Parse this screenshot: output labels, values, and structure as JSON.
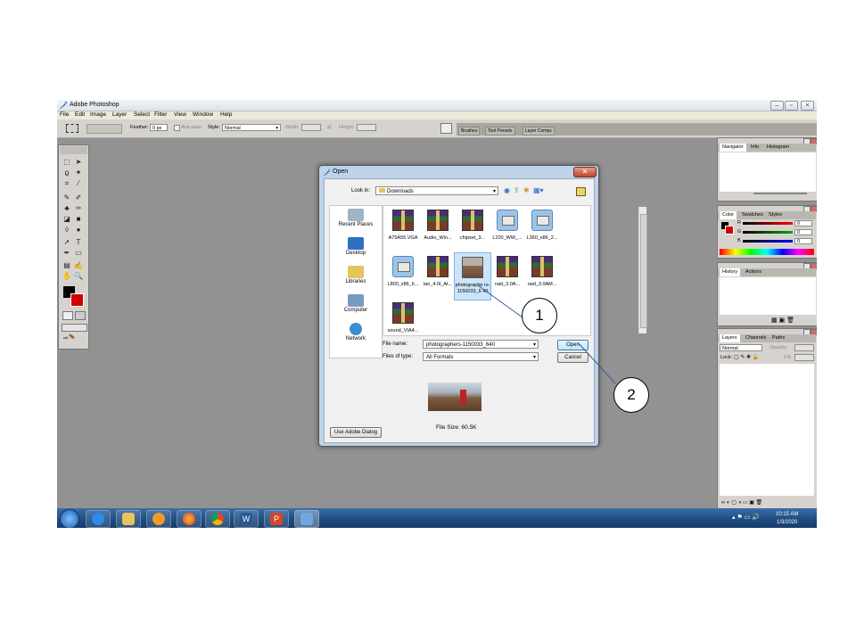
{
  "window": {
    "title": "Adobe Photoshop"
  },
  "menu": [
    "File",
    "Edit",
    "Image",
    "Layer",
    "Select",
    "Filter",
    "View",
    "Window",
    "Help"
  ],
  "options": {
    "feather_label": "Feather:",
    "feather_value": "0 px",
    "antialias_label": "Anti-alias",
    "style_label": "Style:",
    "style_value": "Normal",
    "width_label": "Width:",
    "height_label": "Height:",
    "tabs": [
      "Brushes",
      "Tool Presets",
      "Layer Comps"
    ]
  },
  "panels": {
    "nav": {
      "tabs": [
        "Navigator",
        "Info",
        "Histogram"
      ]
    },
    "color": {
      "tabs": [
        "Color",
        "Swatches",
        "Styles"
      ],
      "r_label": "R",
      "g_label": "G",
      "b_label": "B",
      "r": "0",
      "g": "0",
      "b": "0"
    },
    "history": {
      "tabs": [
        "History",
        "Actions"
      ]
    },
    "layers": {
      "tabs": [
        "Layers",
        "Channels",
        "Paths"
      ],
      "blend": "Normal",
      "opacity_label": "Opacity:",
      "lock_label": "Lock:",
      "fill_label": "Fill:"
    }
  },
  "dialog": {
    "title": "Open",
    "look_in_label": "Look in:",
    "look_in_value": "Downloads",
    "places": [
      "Recent Places",
      "Desktop",
      "Libraries",
      "Computer",
      "Network"
    ],
    "files": [
      {
        "name": "A75A55.VGA",
        "icon": "rar-icon"
      },
      {
        "name": "Audio_Win...",
        "icon": "rar-icon"
      },
      {
        "name": "chipset_3...",
        "icon": "rar-icon"
      },
      {
        "name": "L220_WW_...",
        "icon": "setup-icon"
      },
      {
        "name": "L360_x86_2...",
        "icon": "setup-icon"
      },
      {
        "name": "L800_x86_6...",
        "icon": "setup-icon"
      },
      {
        "name": "lan_4.0l_At...",
        "icon": "rar-icon"
      },
      {
        "name": "photographe rs-1150033_6 40",
        "icon": "image-icon"
      },
      {
        "name": "raid_3.0A...",
        "icon": "rar-icon"
      },
      {
        "name": "raid_3.0AM...",
        "icon": "rar-icon"
      },
      {
        "name": "sound_VIA4...",
        "icon": "rar-icon"
      }
    ],
    "file_name_label": "File name:",
    "file_name_value": "photographers-1150033_640",
    "file_type_label": "Files of type:",
    "file_type_value": "All Formats",
    "open_label": "Open",
    "cancel_label": "Cancel",
    "adobe_dialog_label": "Use Adobe Dialog",
    "file_size": "File Size: 60.5K"
  },
  "callouts": {
    "one": "1",
    "two": "2"
  },
  "taskbar": {
    "apps": [
      "start",
      "ie",
      "explorer",
      "media-player",
      "firefox",
      "chrome",
      "word",
      "powerpoint",
      "photoshop"
    ],
    "time": "10:15 AM",
    "date": "1/3/2020"
  }
}
